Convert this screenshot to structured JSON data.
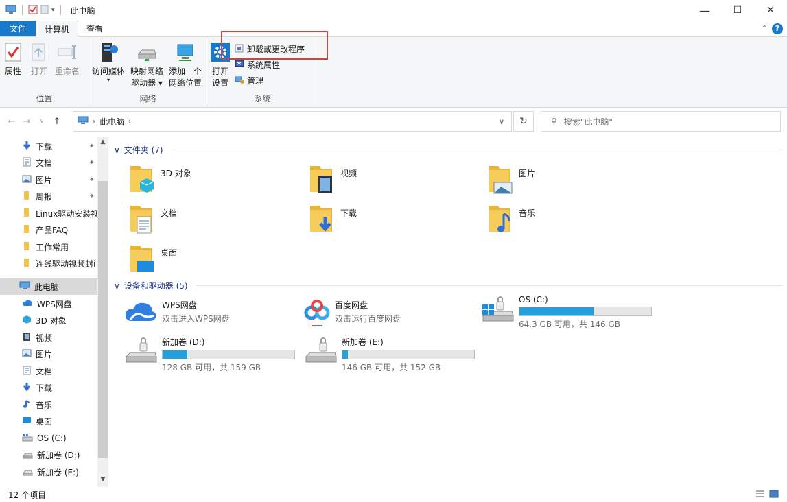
{
  "window": {
    "title": "此电脑",
    "minimize": "—",
    "maximize": "☐",
    "close": "✕"
  },
  "tabs": {
    "file": "文件",
    "computer": "计算机",
    "view": "查看"
  },
  "ribbon": {
    "location": {
      "label": "位置",
      "properties": "属性",
      "open": "打开",
      "rename": "重命名"
    },
    "network": {
      "label": "网络",
      "access_media": "访问媒体",
      "map_drive_line1": "映射网络",
      "map_drive_line2": "驱动器",
      "add_location_line1": "添加一个",
      "add_location_line2": "网络位置"
    },
    "system": {
      "label": "系统",
      "open_settings_line1": "打开",
      "open_settings_line2": "设置",
      "uninstall": "卸载或更改程序",
      "system_properties": "系统属性",
      "manage": "管理"
    }
  },
  "address": {
    "path_item": "此电脑",
    "search_placeholder": "搜索\"此电脑\""
  },
  "nav": {
    "quick": [
      {
        "label": "下载",
        "icon": "download-arrow-icon",
        "pinned": true
      },
      {
        "label": "文档",
        "icon": "document-icon",
        "pinned": true
      },
      {
        "label": "图片",
        "icon": "pictures-icon",
        "pinned": true
      },
      {
        "label": "周报",
        "icon": "folder-icon",
        "pinned": true
      },
      {
        "label": "Linux驱动安装视",
        "icon": "folder-icon",
        "pinned": false
      },
      {
        "label": "产品FAQ",
        "icon": "folder-icon",
        "pinned": false
      },
      {
        "label": "工作常用",
        "icon": "folder-icon",
        "pinned": false
      },
      {
        "label": "连线驱动视频封i",
        "icon": "folder-icon",
        "pinned": false
      }
    ],
    "this_pc": "此电脑",
    "pc_items": [
      {
        "label": "WPS网盘",
        "icon": "cloud-icon"
      },
      {
        "label": "3D 对象",
        "icon": "3d-objects-icon"
      },
      {
        "label": "视频",
        "icon": "video-icon"
      },
      {
        "label": "图片",
        "icon": "pictures-icon"
      },
      {
        "label": "文档",
        "icon": "document-icon"
      },
      {
        "label": "下载",
        "icon": "download-arrow-icon"
      },
      {
        "label": "音乐",
        "icon": "music-note-icon"
      },
      {
        "label": "桌面",
        "icon": "desktop-icon"
      },
      {
        "label": "OS (C:)",
        "icon": "windows-drive-icon"
      },
      {
        "label": "新加卷 (D:)",
        "icon": "drive-icon"
      },
      {
        "label": "新加卷 (E:)",
        "icon": "drive-icon"
      }
    ]
  },
  "content": {
    "folders_header": "文件夹 (7)",
    "folders": [
      {
        "name": "3D 对象",
        "icon": "3d-objects-folder-icon"
      },
      {
        "name": "视频",
        "icon": "video-folder-icon"
      },
      {
        "name": "图片",
        "icon": "pictures-folder-icon"
      },
      {
        "name": "文档",
        "icon": "documents-folder-icon"
      },
      {
        "name": "下载",
        "icon": "downloads-folder-icon"
      },
      {
        "name": "音乐",
        "icon": "music-folder-icon"
      },
      {
        "name": "桌面",
        "icon": "desktop-folder-icon"
      }
    ],
    "devices_header": "设备和驱动器 (5)",
    "devices": [
      {
        "name": "WPS网盘",
        "sub": "双击进入WPS网盘",
        "icon": "wps-cloud-icon"
      },
      {
        "name": "百度网盘",
        "sub": "双击运行百度网盘",
        "icon": "baidu-netdisk-icon"
      },
      {
        "name": "OS (C:)",
        "sub": "64.3 GB 可用，共 146 GB",
        "icon": "windows-drive-icon",
        "used_fraction": 0.56
      },
      {
        "name": "新加卷 (D:)",
        "sub": "128 GB 可用，共 159 GB",
        "icon": "drive-icon",
        "used_fraction": 0.19
      },
      {
        "name": "新加卷 (E:)",
        "sub": "146 GB 可用，共 152 GB",
        "icon": "drive-icon",
        "used_fraction": 0.04
      }
    ]
  },
  "status": {
    "count": "12 个项目"
  },
  "colors": {
    "accent": "#1979ca",
    "highlight_box": "#e53935",
    "bar_fill": "#26a0da",
    "folder": "#f4c542"
  }
}
